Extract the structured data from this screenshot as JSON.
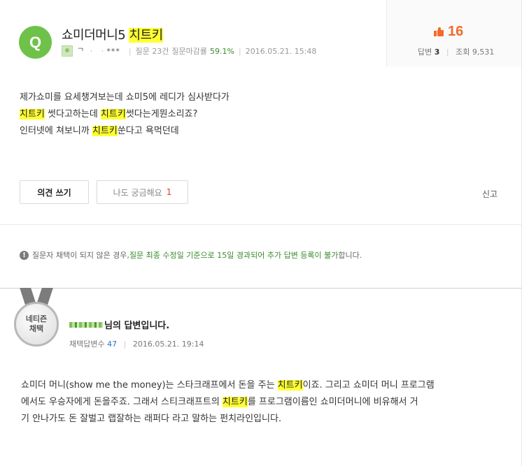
{
  "question": {
    "badge": "Q",
    "title_prefix": "쇼미더머니5 ",
    "title_highlight": "치트키",
    "meta": {
      "user": "ᄀ ᆞ ᆞ***",
      "question_count": "질문 23건",
      "close_rate_label": "질문마감률",
      "close_rate": "59.1%",
      "datetime": "2016.05.21. 15:48"
    },
    "stats": {
      "likes": "16",
      "answers_label": "답변",
      "answers": "3",
      "views_label": "조회",
      "views": "9,531"
    },
    "body": {
      "line1": "제가쇼미를 요세챙겨보는데 쇼미5에 레디가 심사받다가",
      "line2_hl1": "치트키",
      "line2_mid": " 썻다고하는데 ",
      "line2_hl2": "치트키",
      "line2_end": "썻다는게뭔소리죠?",
      "line3_pre": "인터넷에 쳐보니까 ",
      "line3_hl": "치트키",
      "line3_end": "쑨다고 욕먹던데"
    },
    "buttons": {
      "opinion": "의견 쓰기",
      "curious": "나도 궁금해요",
      "curious_count": "1",
      "report": "신고"
    },
    "notice": {
      "pre": "질문자 채택이 되지 않은 경우, ",
      "green": "질문 최종 수정일 기준으로 15일 경과되어 추가 답변 등록이 불가",
      "post": "합니다."
    }
  },
  "answer": {
    "medal_line1": "네티즌",
    "medal_line2": "채택",
    "name_suffix": "님의 답변입니다.",
    "meta_label": "채택답변수",
    "meta_count": "47",
    "datetime": "2016.05.21. 19:14",
    "body": {
      "l1_pre": "쇼미더 머니(show me the money)는 스타크래프에서 돈을 주는 ",
      "l1_hl": "치트키",
      "l1_post": "이죠. 그리고 쇼미더 머니 프로그램",
      "l2_pre": "에서도 우승자에게 돈을주죠. 그래서 스티크래프트의 ",
      "l2_hl": "치트키",
      "l2_post": "를 프로그램이름인 쇼미더머니에 비유해서 거",
      "l3": "기 안나가도 돈 잘벌고 랩잘하는 래퍼다 라고 말하는 펀치라인입니다."
    }
  }
}
